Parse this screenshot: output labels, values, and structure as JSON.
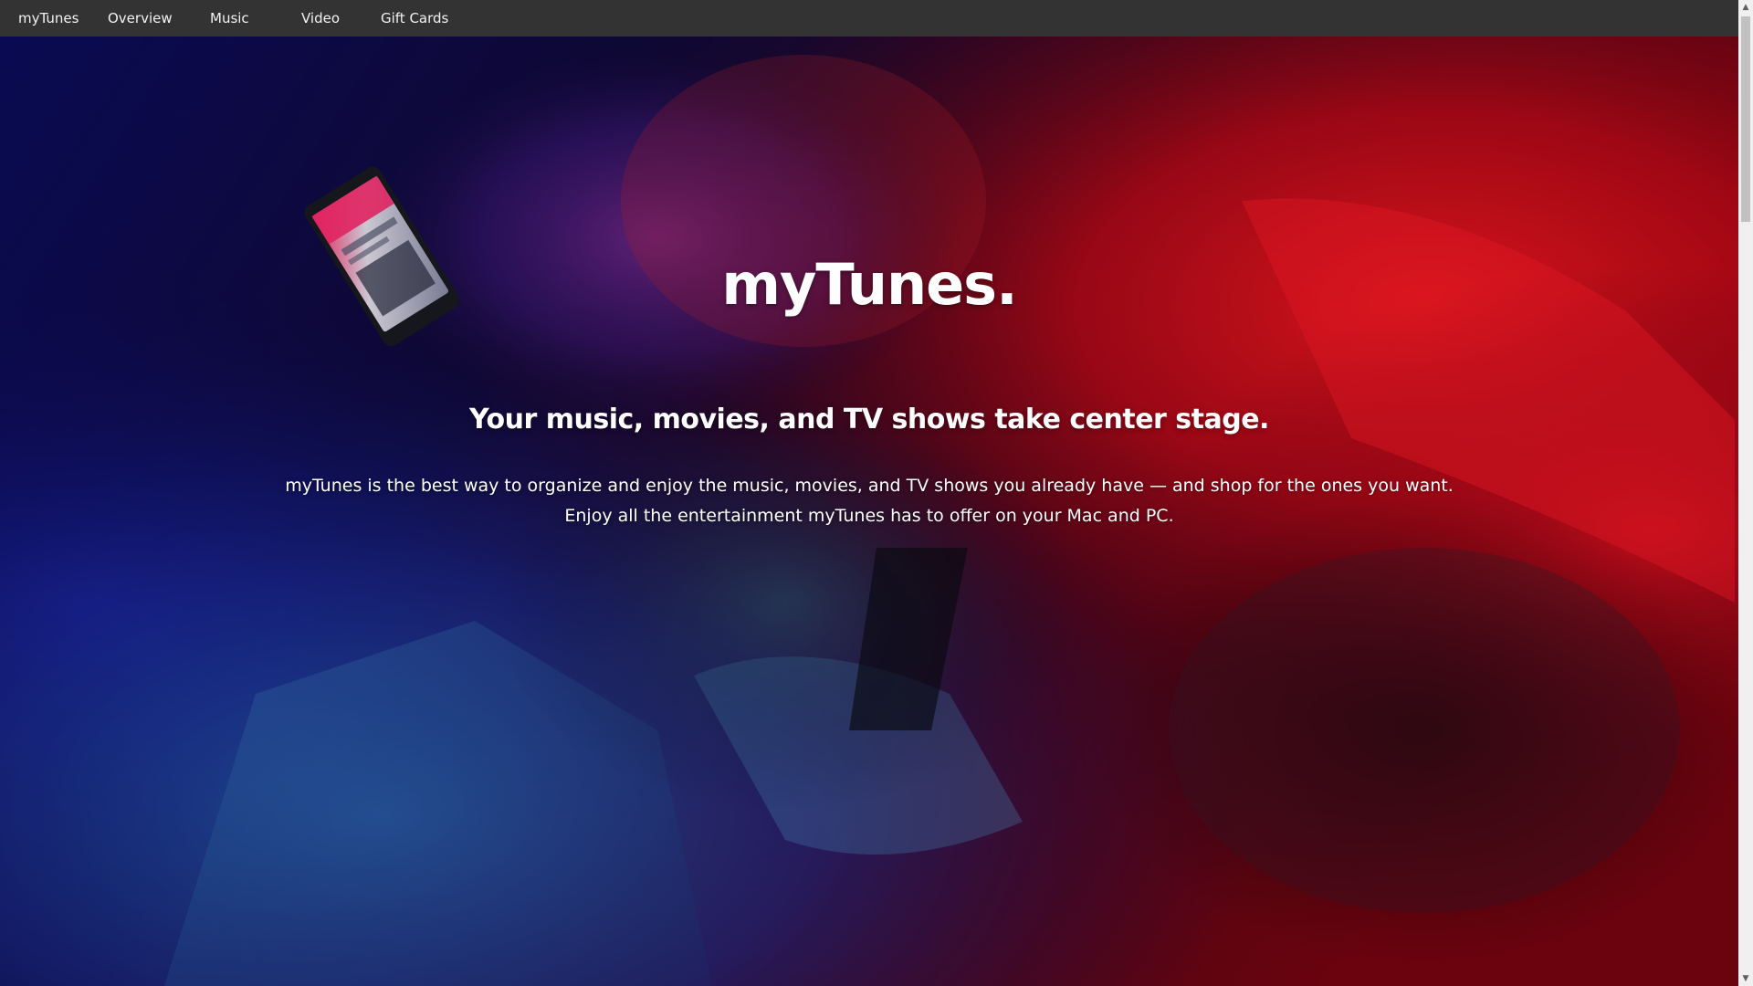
{
  "nav": {
    "brand": "myTunes",
    "items": [
      {
        "label": "Overview"
      },
      {
        "label": "Music"
      },
      {
        "label": "Video"
      },
      {
        "label": "Gift Cards"
      }
    ]
  },
  "hero": {
    "title": "myTunes.",
    "subtitle": "Your music, movies, and TV shows take center stage.",
    "description_line1": "myTunes is the best way to organize and enjoy the music, movies, and TV shows you already have — and shop for the ones you want.",
    "description_line2": "Enjoy all the entertainment myTunes has to offer on your Mac and PC.",
    "background_image": "person-with-phone-hero-photo"
  },
  "colors": {
    "nav_background": "#333333",
    "nav_text": "#f2f2f2",
    "hero_text": "#ffffff",
    "accent_red": "#d0101c",
    "accent_blue": "#1a2a9a"
  },
  "scrollbar": {
    "up_icon": "arrow-up-icon",
    "down_icon": "arrow-down-icon"
  }
}
